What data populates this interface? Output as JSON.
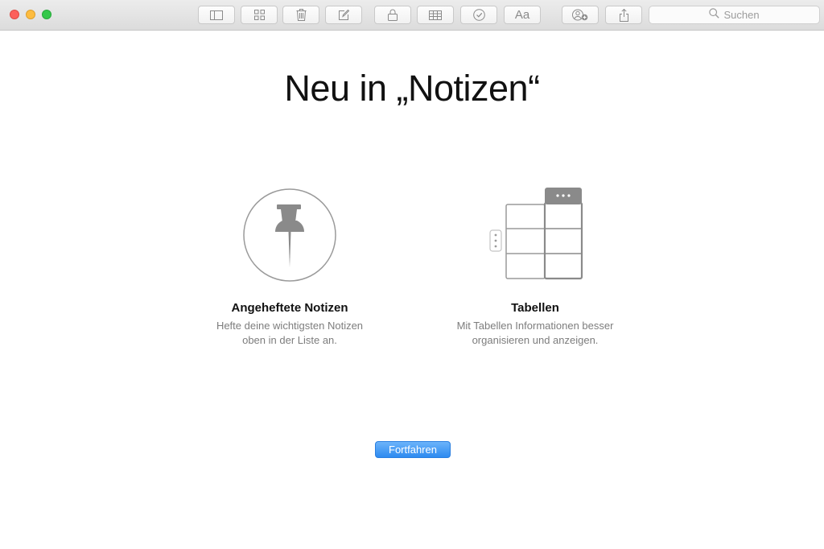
{
  "toolbar": {
    "buttons": [
      {
        "icon": "sidebar-icon"
      },
      {
        "icon": "grid-view-icon"
      },
      {
        "icon": "trash-icon"
      },
      {
        "icon": "compose-icon"
      },
      {
        "icon": "lock-icon"
      },
      {
        "icon": "table-icon"
      },
      {
        "icon": "checklist-icon"
      },
      {
        "icon": "text-format-icon",
        "label": "Aa"
      },
      {
        "icon": "add-people-icon"
      },
      {
        "icon": "share-icon"
      }
    ],
    "search": {
      "placeholder": "Suchen",
      "icon": "search-icon"
    }
  },
  "welcome": {
    "title": "Neu in „Notizen“",
    "features": [
      {
        "icon": "pin-icon",
        "title": "Angeheftete Notizen",
        "description": "Hefte deine wichtigsten Notizen\noben in der Liste an."
      },
      {
        "icon": "table-illustration-icon",
        "title": "Tabellen",
        "description": "Mit Tabellen Informationen besser\norganisieren und anzeigen."
      }
    ],
    "continue_label": "Fortfahren"
  },
  "colors": {
    "accent": "#2d8bf0",
    "icon_gray": "#8a8a8a",
    "traffic_close": "#fc605b",
    "traffic_minimize": "#fdbc40",
    "traffic_zoom": "#34c84a"
  }
}
